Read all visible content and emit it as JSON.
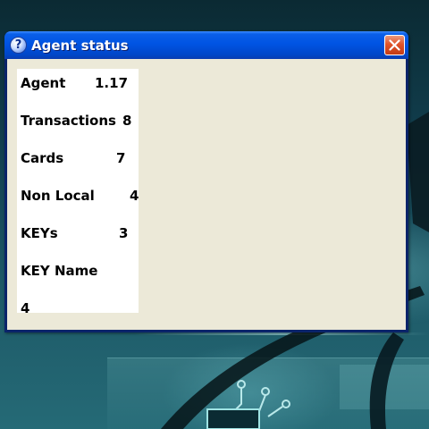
{
  "window": {
    "title": "Agent status",
    "icon": "help-question-icon",
    "close_icon": "close-icon"
  },
  "status": [
    {
      "label": "Agent",
      "value": "1.17"
    },
    {
      "label": "Transactions",
      "value": "8"
    },
    {
      "label": "Cards",
      "value": "7"
    },
    {
      "label": "Non Local",
      "value": "4"
    },
    {
      "label": "KEYs",
      "value": "3"
    },
    {
      "label": "KEY Name",
      "value": ""
    },
    {
      "label": "4",
      "value": ""
    }
  ],
  "colors": {
    "titlebar": "#0054e3",
    "client": "#ece9d8",
    "close_button": "#e0542a",
    "panel": "#ffffff"
  }
}
